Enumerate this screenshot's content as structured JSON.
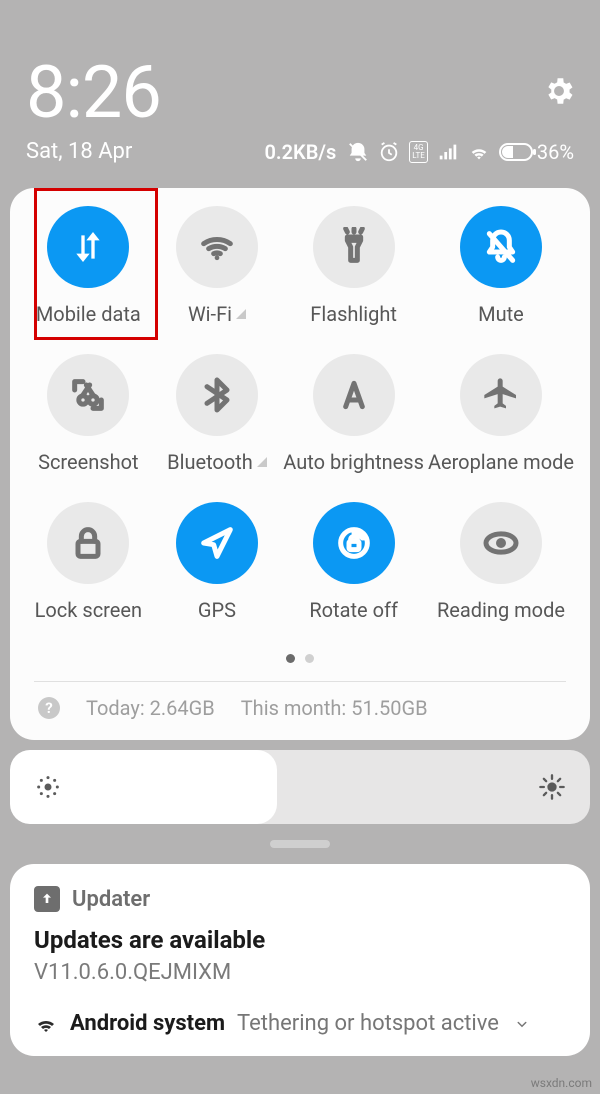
{
  "status": {
    "time": "8:26",
    "date": "Sat, 18 Apr",
    "speed": "0.2KB/s",
    "net_badge": "4G LTE",
    "battery": "36%"
  },
  "qs": {
    "mobile_data": "Mobile data",
    "wifi": "Wi-Fi",
    "flashlight": "Flashlight",
    "mute": "Mute",
    "screenshot": "Screenshot",
    "bluetooth": "Bluetooth",
    "auto_bright": "Auto brightness",
    "airplane": "Aeroplane mode",
    "lock": "Lock screen",
    "gps": "GPS",
    "rotate": "Rotate off",
    "reading": "Reading mode"
  },
  "usage": {
    "today_label": "Today:",
    "today_val": "2.64GB",
    "month_label": "This month:",
    "month_val": "51.50GB"
  },
  "notif": {
    "updater_app": "Updater",
    "updater_title": "Updates are available",
    "updater_version": "V11.0.6.0.QEJMIXM",
    "sys_app": "Android system",
    "sys_msg": "Tethering or hotspot active"
  },
  "watermark": "wsxdn.com"
}
